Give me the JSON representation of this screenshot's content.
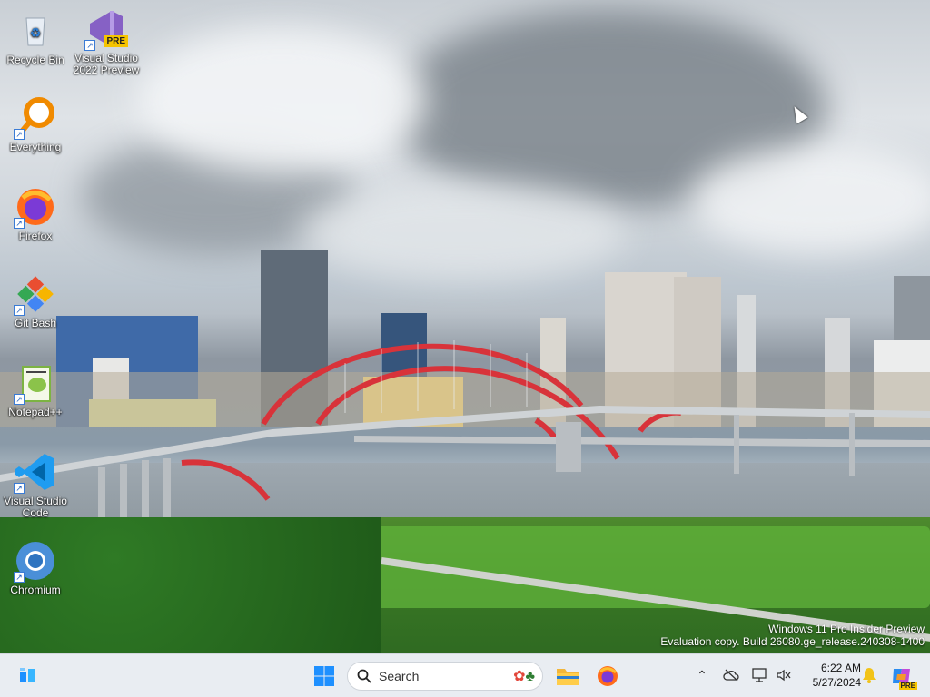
{
  "desktop_icons": [
    {
      "label": "Recycle Bin",
      "icon": "recycle-bin-icon"
    },
    {
      "label": "Visual Studio 2022 Preview",
      "icon": "visual-studio-icon",
      "badge": "PRE"
    },
    {
      "label": "Everything",
      "icon": "everything-search-icon"
    },
    {
      "label": "Firefox",
      "icon": "firefox-icon"
    },
    {
      "label": "Git Bash",
      "icon": "git-bash-icon"
    },
    {
      "label": "Notepad++",
      "icon": "notepad-plus-plus-icon"
    },
    {
      "label": "Visual Studio Code",
      "icon": "vscode-icon"
    },
    {
      "label": "Chromium",
      "icon": "chromium-icon"
    }
  ],
  "watermark": {
    "line1": "Windows 11 Pro Insider Preview",
    "line2": "Evaluation copy. Build 26080.ge_release.240308-1400"
  },
  "taskbar": {
    "search_placeholder": "Search",
    "clock": {
      "time": "6:22 AM",
      "date": "5/27/2024"
    },
    "copilot_badge": "PRE"
  },
  "colors": {
    "taskbar_bg": "#e9edf2",
    "bridge_red": "#d8333a",
    "windows_blue": "#1e90ff"
  }
}
